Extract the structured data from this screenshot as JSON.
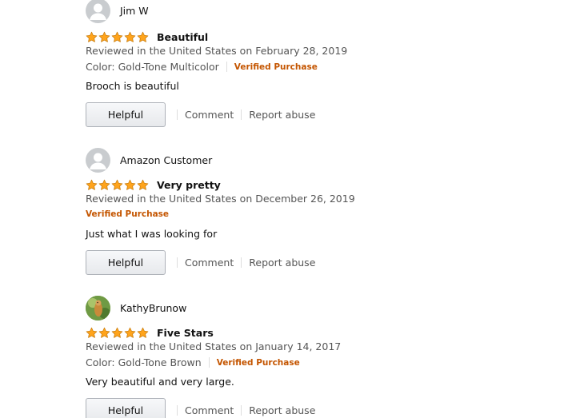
{
  "reviews": [
    {
      "name": "Jim W",
      "avatar": "default-avatar",
      "rating": 5,
      "title": "Beautiful",
      "date": "Reviewed in the United States on February 28, 2019",
      "color": "Color: Gold-Tone Multicolor",
      "verified": "Verified Purchase",
      "body": "Brooch is beautiful",
      "helpful": "Helpful",
      "comment": "Comment",
      "report": "Report abuse"
    },
    {
      "name": "Amazon Customer",
      "avatar": "default-avatar",
      "rating": 5,
      "title": "Very pretty",
      "date": "Reviewed in the United States on December 26, 2019",
      "verified": "Verified Purchase",
      "body": "Just what I was looking for",
      "helpful": "Helpful",
      "comment": "Comment",
      "report": "Report abuse"
    },
    {
      "name": "KathyBrunow",
      "avatar": "photo-avatar",
      "rating": 5,
      "title": "Five Stars",
      "date": "Reviewed in the United States on January 14, 2017",
      "color": "Color: Gold-Tone Brown",
      "verified": "Verified Purchase",
      "body": "Very beautiful and very large.",
      "helpful": "Helpful",
      "comment": "Comment",
      "report": "Report abuse"
    }
  ],
  "colors": {
    "star": "#ffa41c",
    "verified": "#c45500",
    "meta": "#555555"
  }
}
